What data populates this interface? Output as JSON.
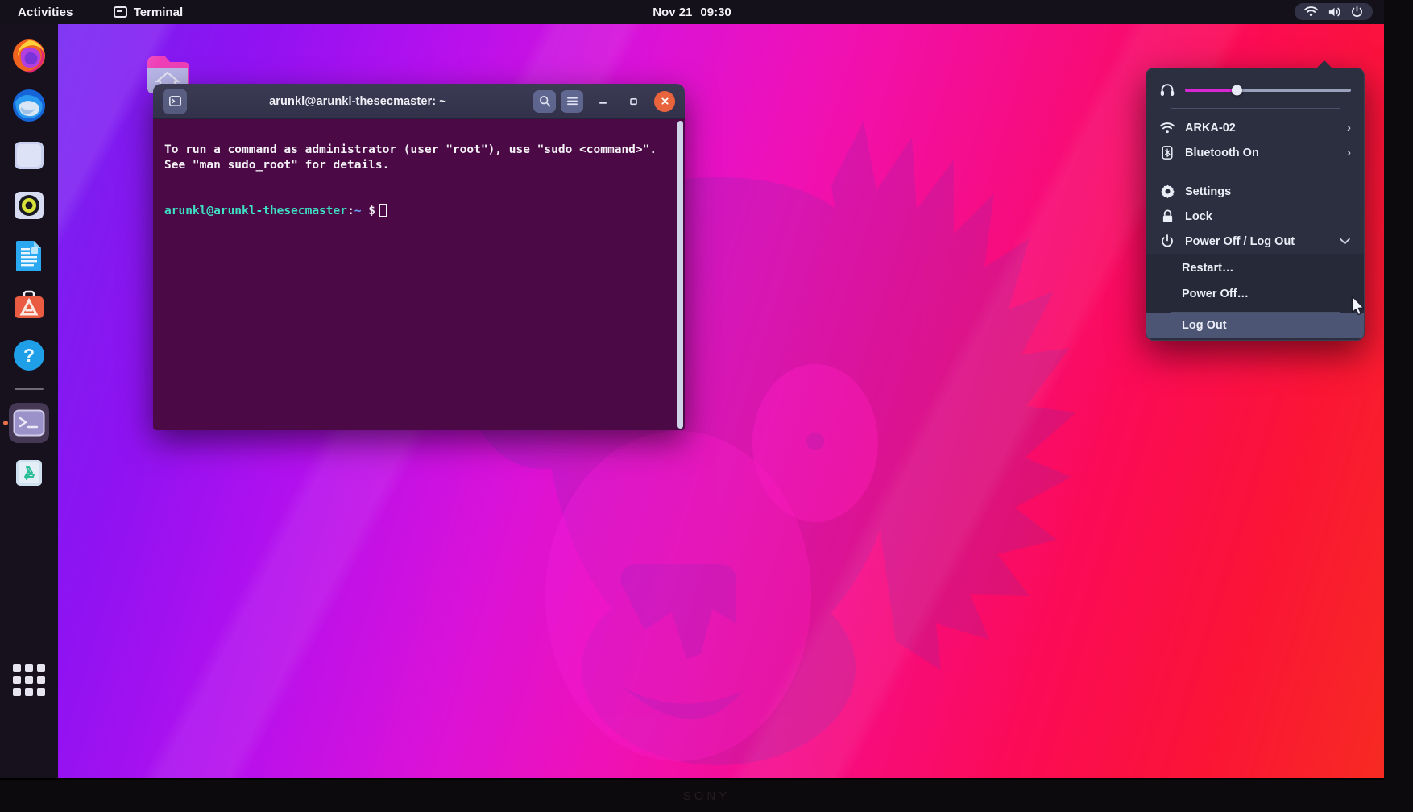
{
  "top_bar": {
    "activities_label": "Activities",
    "app_indicator_label": "Terminal",
    "app_indicator_icon": "terminal-icon",
    "clock_date": "Nov 21",
    "clock_time": "09:30",
    "status_icons": [
      "wifi-icon",
      "volume-icon",
      "power-icon"
    ]
  },
  "dock": {
    "items": [
      {
        "name": "firefox",
        "label": "Firefox",
        "icon": "firefox-icon",
        "running": false
      },
      {
        "name": "thunderbird",
        "label": "Thunderbird Mail",
        "icon": "thunderbird-icon",
        "running": false
      },
      {
        "name": "files",
        "label": "Files",
        "icon": "files-icon",
        "running": false
      },
      {
        "name": "rhythmbox",
        "label": "Rhythmbox",
        "icon": "rhythmbox-icon",
        "running": false
      },
      {
        "name": "libreoffice-writer",
        "label": "LibreOffice Writer",
        "icon": "document-icon",
        "running": false
      },
      {
        "name": "ubuntu-software",
        "label": "Ubuntu Software",
        "icon": "software-store-icon",
        "running": false
      },
      {
        "name": "help",
        "label": "Help",
        "icon": "help-icon",
        "running": false
      },
      {
        "name": "terminal",
        "label": "Terminal",
        "icon": "terminal-icon",
        "running": true
      },
      {
        "name": "trash",
        "label": "Trash",
        "icon": "trash-icon",
        "running": false
      }
    ],
    "show_applications_label": "Show Applications"
  },
  "desktop": {
    "home_folder_label": "",
    "home_folder_icon": "home-folder-icon",
    "wallpaper": "ubuntu-impish-indri-lemur"
  },
  "terminal": {
    "title": "arunkl@arunkl-thesecmaster: ~",
    "tab_icon": "terminal-tab-icon",
    "buttons": {
      "search": "search-icon",
      "menu": "hamburger-menu-icon",
      "minimize": "minimize-icon",
      "maximize": "maximize-icon",
      "close": "close-icon"
    },
    "output_line_1": "To run a command as administrator (user \"root\"), use \"sudo <command>\".",
    "output_line_2": "See \"man sudo_root\" for details.",
    "prompt": {
      "user_host": "arunkl@arunkl-thesecmaster",
      "colon": ":",
      "path": "~",
      "symbol": "$"
    }
  },
  "system_menu": {
    "volume": {
      "icon": "headphones-icon",
      "level_percent": 31
    },
    "rows": [
      {
        "name": "wifi",
        "icon": "wifi-icon",
        "label": "ARKA-02",
        "chevron": "›"
      },
      {
        "name": "bluetooth",
        "icon": "bluetooth-icon",
        "label": "Bluetooth On",
        "chevron": "›"
      }
    ],
    "actions": [
      {
        "name": "settings",
        "icon": "gear-icon",
        "label": "Settings"
      },
      {
        "name": "lock",
        "icon": "lock-icon",
        "label": "Lock"
      },
      {
        "name": "power-off-log-out",
        "icon": "power-icon",
        "label": "Power Off / Log Out",
        "chevron": "⌄",
        "expanded": true
      }
    ],
    "power_submenu": [
      {
        "name": "restart",
        "label": "Restart…",
        "highlighted": false
      },
      {
        "name": "power-off",
        "label": "Power Off…",
        "highlighted": false
      },
      {
        "name": "log-out",
        "label": "Log Out",
        "highlighted": true
      }
    ]
  },
  "monitor": {
    "brand_logo": "SONY"
  },
  "colors": {
    "accent_orange": "#e9643c",
    "menu_background": "#2b2f3f",
    "menu_highlight": "#4c5574",
    "terminal_background": "#4b0a45",
    "volume_fill": "#d926d4"
  }
}
